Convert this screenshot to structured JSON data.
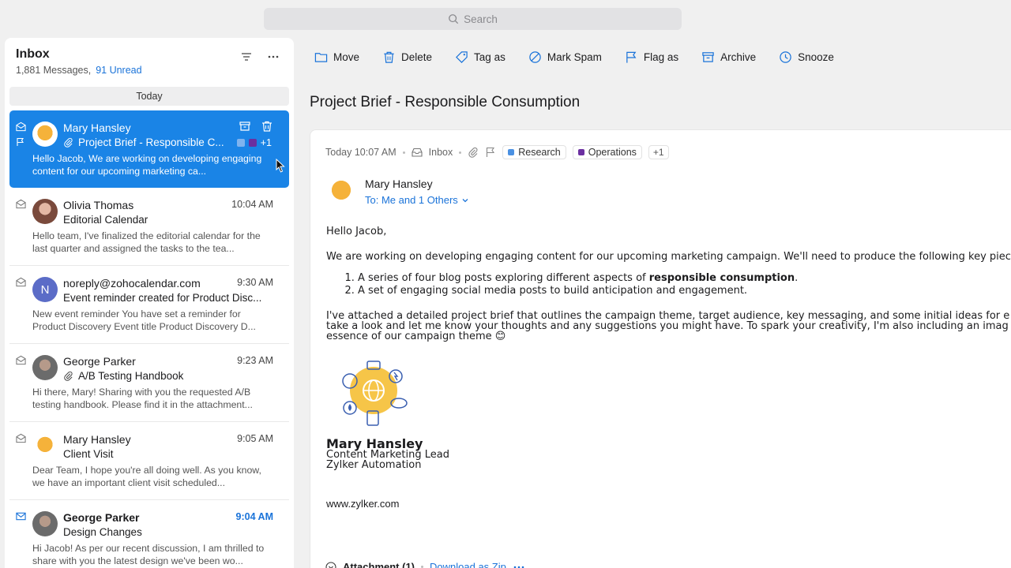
{
  "search": {
    "placeholder": "Search"
  },
  "inbox": {
    "title": "Inbox",
    "message_count": "1,881 Messages,",
    "unread": "91 Unread",
    "date_group": "Today"
  },
  "messages": [
    {
      "sender": "Mary Hansley",
      "subject": "Project Brief - Responsible C...",
      "preview": "Hello Jacob, We are working on developing engaging content for our upcoming marketing ca...",
      "extra_tags": "+1"
    },
    {
      "sender": "Olivia Thomas",
      "time": "10:04 AM",
      "subject": "Editorial Calendar",
      "preview": "Hello team, I've finalized the editorial calendar for the last quarter and assigned the tasks to the tea..."
    },
    {
      "sender": "noreply@zohocalendar.com",
      "avatar_letter": "N",
      "time": "9:30 AM",
      "subject": "Event reminder created for Product Disc...",
      "preview": "New event reminder You have set a reminder for Product Discovery Event title Product Discovery D..."
    },
    {
      "sender": "George Parker",
      "time": "9:23 AM",
      "subject": "A/B Testing Handbook",
      "preview": "Hi there, Mary! Sharing with you the requested A/B testing handbook. Please find it in the attachment..."
    },
    {
      "sender": "Mary Hansley",
      "time": "9:05 AM",
      "subject": "Client Visit",
      "preview": "Dear Team, I hope you're all doing well. As you know, we have an important client visit scheduled..."
    },
    {
      "sender": "George Parker",
      "time": "9:04 AM",
      "subject": "Design Changes",
      "preview": "Hi Jacob! As per our recent discussion, I am thrilled to share with you the latest design we've been wo..."
    }
  ],
  "toolbar": {
    "move": "Move",
    "delete": "Delete",
    "tag": "Tag as",
    "spam": "Mark Spam",
    "flag": "Flag as",
    "archive": "Archive",
    "snooze": "Snooze"
  },
  "mail": {
    "title": "Project Brief - Responsible Consumption",
    "time": "Today 10:07 AM",
    "folder": "Inbox",
    "labels": [
      {
        "name": "Research",
        "color": "#4a90e2"
      },
      {
        "name": "Operations",
        "color": "#6b2fa0"
      }
    ],
    "more_labels": "+1",
    "from": "Mary Hansley",
    "to": "To: Me and 1 Others",
    "greeting": "Hello Jacob,",
    "intro": "We are working on developing engaging content for our upcoming marketing campaign. We'll need to produce the following key piec",
    "list": [
      {
        "before": "A series of four blog posts exploring different aspects of ",
        "bold": "responsible consumption",
        "after": "."
      },
      {
        "text": "A set of engaging social media posts to build anticipation and engagement."
      }
    ],
    "para_line1": "I've attached a detailed project brief that outlines the campaign theme, target audience, key messaging, and some initial ideas for e",
    "para_line2": "take a look and let me know your thoughts and any suggestions you might have. To spark your creativity, I'm also including an imag",
    "para_line3": "essence of our campaign theme 😊",
    "signature": {
      "name": "Mary Hansley",
      "role": "Content Marketing Lead",
      "company": "Zylker Automation",
      "website": "www.zylker.com"
    },
    "attachment_label": "Attachment (1)",
    "download": "Download as Zip"
  },
  "colors": {
    "accent": "#1a84e6",
    "link": "#1a73d9"
  }
}
